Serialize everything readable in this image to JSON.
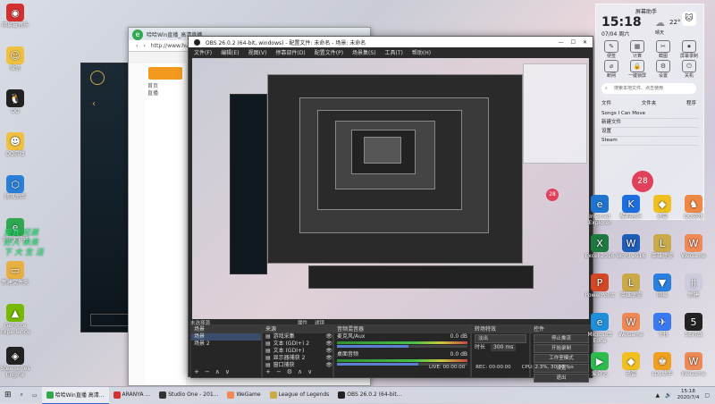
{
  "colors": {
    "obs_dark": "#2b2b2b",
    "obs_selected": "#3b4c6b",
    "accent": "#2f8f2f",
    "red_badge": "#e0405a"
  },
  "desktop_icons_left": [
    {
      "label": "网易云音乐",
      "icon": "netease-music-icon",
      "color": "#d4302f",
      "glyph": "◉"
    },
    {
      "label": "微信",
      "icon": "qq-pet-icon",
      "color": "#f0c040",
      "glyph": "☺"
    },
    {
      "label": "QQ",
      "icon": "qq-icon",
      "color": "#222",
      "glyph": "🐧"
    },
    {
      "label": "QQ游戏",
      "icon": "qq-game-icon",
      "color": "#f0c040",
      "glyph": "☻"
    },
    {
      "label": "腾讯助手",
      "icon": "tencent-helper-icon",
      "color": "#2a7fd8",
      "glyph": "⬡"
    },
    {
      "label": "360浏览器",
      "icon": "ie-browser-icon",
      "color": "#2fa84f",
      "glyph": "e"
    },
    {
      "label": "新建文件夹",
      "icon": "folder-icon",
      "color": "#e8b040",
      "glyph": "▭"
    },
    {
      "label": "GeForce Experience",
      "icon": "geforce-icon",
      "color": "#76b900",
      "glyph": "▲"
    },
    {
      "label": "Steelseries Engine",
      "icon": "steelseries-icon",
      "color": "#222",
      "glyph": "◈"
    }
  ],
  "green_overlay_text": [
    "爱我 兄弟",
    "好人 未来",
    "下 大 生 活"
  ],
  "browser": {
    "tab_title": "哈哈Win直播_高清直播 ...",
    "address": "http://www.huya.com",
    "nav_items": [
      "首页",
      "直播"
    ]
  },
  "obs": {
    "title": "OBS 26.0.2 (64-bit, windows) - 配置文件: 未命名 - 场景: 未命名",
    "menu": [
      "文件(F)",
      "编辑(E)",
      "视图(V)",
      "停靠部件(D)",
      "配置文件(P)",
      "场景集(S)",
      "工具(T)",
      "帮助(H)"
    ],
    "filter_label": "未选择源",
    "properties_btn": "属性",
    "filters_btn": "滤镜",
    "scenes_title": "场景",
    "scenes": [
      "场景",
      "场景 2"
    ],
    "sources_title": "来源",
    "sources": [
      "游戏采集",
      "文本 (GDI+) 2",
      "文本 (GDI+)",
      "显示器捕获 2",
      "窗口捕获"
    ],
    "mixer_title": "音频混音器",
    "mixer": [
      {
        "name": "麦克风/Aux",
        "db": "0.0 dB",
        "level": 0.55
      },
      {
        "name": "桌面音频",
        "db": "0.0 dB",
        "level": 0.62
      }
    ],
    "transitions_title": "转场特效",
    "transition_value": "淡出",
    "duration_label": "时长",
    "duration_value": "300 ms",
    "controls_title": "控件",
    "controls": [
      "停止推流",
      "开始录制",
      "工作室模式",
      "设置",
      "退出"
    ],
    "status": {
      "live": "LIVE: 00:00:00",
      "rec": "REC: 00:00:00",
      "cpu": "CPU: 2.3%, 30.00 fps"
    }
  },
  "panel": {
    "time": "15:18",
    "date": "07/04 周六",
    "weather_temp": "22°",
    "weather_label": "晴天",
    "header_label": "屏幕助手",
    "quick_actions": [
      "便签",
      "计算",
      "截图",
      "屏幕录制",
      "断网",
      "一键锁屏",
      "设置",
      "关机"
    ],
    "search_placeholder": "搜索本地文件、点击使用",
    "tabs": [
      "文件",
      "文件夹",
      "程序"
    ],
    "files": [
      "Songs I Can Move",
      "新建文件",
      "设置",
      "Steam"
    ],
    "badge": "28"
  },
  "desktop_icons_right": [
    {
      "label": "Internet Explorer",
      "icon": "ie-icon",
      "color": "#1e74d0",
      "glyph": "e"
    },
    {
      "label": "酷狗音乐",
      "icon": "kugou-icon",
      "color": "#1c6fe0",
      "glyph": "K"
    },
    {
      "label": "迅雷",
      "icon": "thunder-icon",
      "color": "#f0c020",
      "glyph": "◆"
    },
    {
      "label": "QQ游戏",
      "icon": "qqgame-icon",
      "color": "#e84",
      "glyph": "♞"
    },
    {
      "label": "Excel 2016",
      "icon": "excel-icon",
      "color": "#1d7a3e",
      "glyph": "X"
    },
    {
      "label": "Word 2016",
      "icon": "word-icon",
      "color": "#1e5db8",
      "glyph": "W"
    },
    {
      "label": "英雄联盟",
      "icon": "lol-icon",
      "color": "#c9a94a",
      "glyph": "L"
    },
    {
      "label": "WeGame",
      "icon": "wegame-icon",
      "color": "#e85",
      "glyph": "W"
    },
    {
      "label": "PowerPoint",
      "icon": "powerpoint-icon",
      "color": "#d24726",
      "glyph": "P"
    },
    {
      "label": "英雄联盟",
      "icon": "lol2-icon",
      "color": "#c9a94a",
      "glyph": "L"
    },
    {
      "label": "网易",
      "icon": "netease-icon",
      "color": "#2a80e0",
      "glyph": "▼"
    },
    {
      "label": "新建",
      "icon": "blank-file-icon",
      "color": "#ccd",
      "glyph": "▯"
    },
    {
      "label": "Microsoft Edge",
      "icon": "edge-icon",
      "color": "#1e8fd8",
      "glyph": "e"
    },
    {
      "label": "WeGame",
      "icon": "wegame2-icon",
      "color": "#e85",
      "glyph": "W"
    },
    {
      "label": "飞书",
      "icon": "feishu-icon",
      "color": "#3a7af0",
      "glyph": "✈"
    },
    {
      "label": "5E对战",
      "icon": "5e-icon",
      "color": "#222",
      "glyph": "5"
    },
    {
      "label": "爱奇艺",
      "icon": "iqiyi-icon",
      "color": "#2dbb4f",
      "glyph": "▶"
    },
    {
      "label": "迅雷",
      "icon": "thunder2-icon",
      "color": "#f0c020",
      "glyph": "◆"
    },
    {
      "label": "LOL助手",
      "icon": "lol-helper-icon",
      "color": "#f0a020",
      "glyph": "♚"
    },
    {
      "label": "WeGame",
      "icon": "wegame3-icon",
      "color": "#e85",
      "glyph": "W"
    }
  ],
  "taskbar": {
    "items": [
      {
        "label": "哈哈Win直播 高清...",
        "icon": "browser-task-icon",
        "color": "#2fa84f"
      },
      {
        "label": "ARANYA ... ",
        "icon": "music-task-icon",
        "color": "#d4302f"
      },
      {
        "label": "Studio One - 201...",
        "icon": "studio-task-icon",
        "color": "#333"
      },
      {
        "label": "WeGame",
        "icon": "wegame-task-icon",
        "color": "#e85"
      },
      {
        "label": "League of Legends",
        "icon": "lol-task-icon",
        "color": "#c9a94a"
      },
      {
        "label": "OBS 26.0.2 (64-bit...",
        "icon": "obs-task-icon",
        "color": "#222"
      }
    ],
    "clock_time": "15:18",
    "clock_date": "2020/7/4"
  }
}
